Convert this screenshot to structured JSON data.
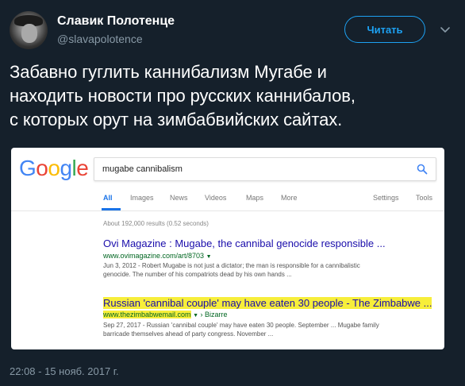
{
  "author": {
    "name": "Славик Полотенце",
    "handle": "@slavapolotence",
    "follow_label": "Читать"
  },
  "tweet": {
    "text_lines": [
      "Забавно гуглить каннибализм Мугабе и",
      "находить новости про русских каннибалов,",
      "с которых орут на зимбабвийских сайтах."
    ],
    "timestamp": "22:08 - 15 нояб. 2017 г."
  },
  "screenshot": {
    "logo_letters": [
      {
        "ch": "G",
        "color": "#4285f4"
      },
      {
        "ch": "o",
        "color": "#ea4335"
      },
      {
        "ch": "o",
        "color": "#fbbc05"
      },
      {
        "ch": "g",
        "color": "#4285f4"
      },
      {
        "ch": "l",
        "color": "#34a853"
      },
      {
        "ch": "e",
        "color": "#ea4335"
      }
    ],
    "query": "mugabe cannibalism",
    "tabs": [
      "All",
      "Images",
      "News",
      "Videos",
      "Maps",
      "More",
      "Settings",
      "Tools"
    ],
    "stats": "About 192,000 results (0.52 seconds)",
    "results": [
      {
        "title": "Ovi Magazine : Mugabe, the cannibal genocide responsible ...",
        "url": "www.ovimagazine.com/art/8703",
        "snippet_line1": "Jun 3, 2012 - Robert Mugabe is not just a dictator; the man is responsible for a cannibalistic",
        "snippet_line2": "genocide. The number of his compatriots dead by his own hands ..."
      },
      {
        "title": "Russian 'cannibal couple' may have eaten 30 people - The Zimbabwe ...",
        "url": "www.thezimbabwemail.com",
        "url_extra": "› Bizarre",
        "snippet_line1": "Sep 27, 2017 - Russian 'cannibal couple' may have eaten 30 people. September ... Mugabe family",
        "snippet_line2": "barricade themselves ahead of party congress. November ..."
      }
    ]
  },
  "icons": {
    "caret": "chevron-down-icon",
    "search": "search-icon"
  }
}
